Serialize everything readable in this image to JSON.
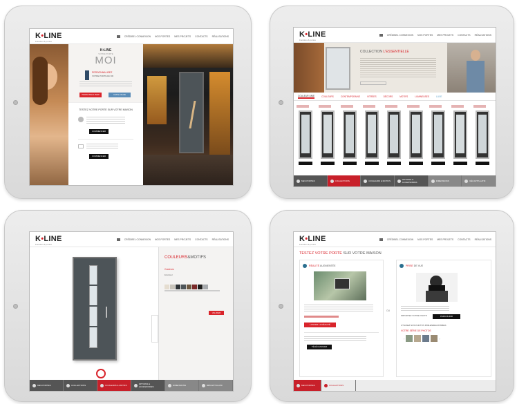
{
  "brand": {
    "logo_k": "K",
    "logo_sep": "•",
    "logo_line": "LINE",
    "tagline": "Fenêtres & portes"
  },
  "nav": [
    "Crédibel connexion",
    "Nos portes",
    "Mes projets",
    "Contacts",
    "Réalisations"
  ],
  "screen1": {
    "brand_small": "K•LINE",
    "subtitle": "Votre porte",
    "hero": "MOI",
    "sub1": "PERSONNALISEZ",
    "sub2": "VOTRE PORTE EN 3D",
    "btn_personalize": "Personnaliser",
    "btn_catalog": "Catalogue",
    "test_title": "TESTEZ VOTRE PORTE SUR VOTRE MAISON",
    "btn1": "Commencer",
    "btn2": "Commencer"
  },
  "screen2": {
    "collection_title": "COLLECTION",
    "collection_accent": "L'ESSENTIELLE",
    "tabs": [
      "Couleur unie",
      "Couleurs",
      "Contemporaine",
      "Vitrées",
      "Décors",
      "Motifs",
      "Lumineuses",
      "Luxe"
    ],
    "active_tab": "Couleur unie"
  },
  "screen3": {
    "title_a": "COULEURS",
    "title_b": "&MOTIFS",
    "label": "Couleurs",
    "section": "Extérieur",
    "action": "Valider"
  },
  "screen4": {
    "title_a": "TESTEZ VOTRE PORTE",
    "title_b": "SUR VOTRE MAISON",
    "left_a": "RÉALITÉ",
    "left_b": "AUGMENTÉE",
    "right_a": "PRISE",
    "right_b": "DE VUE",
    "btn_left": "Lancer la réalité augmentée",
    "btn_left2": "Télécharger",
    "btn_right": "Parcourir",
    "photos": "VOTRE SÉRIE DE PHOTOS",
    "upload_1": "IMPORTEZ VOTRE PHOTO",
    "upload_2": "UTILISEZ NOS PHOTOS PRÉ-ENREGISTRÉES",
    "or": "OU"
  },
  "footer_items": [
    {
      "label": "Mes portes"
    },
    {
      "label": "Collections"
    },
    {
      "label": "Couleurs & motifs"
    },
    {
      "label": "Options & accessoires"
    },
    {
      "label": "Dimensions"
    },
    {
      "label": "Récapitulatif"
    }
  ],
  "colors": {
    "accent": "#d9242b",
    "door": "#4d5458"
  }
}
